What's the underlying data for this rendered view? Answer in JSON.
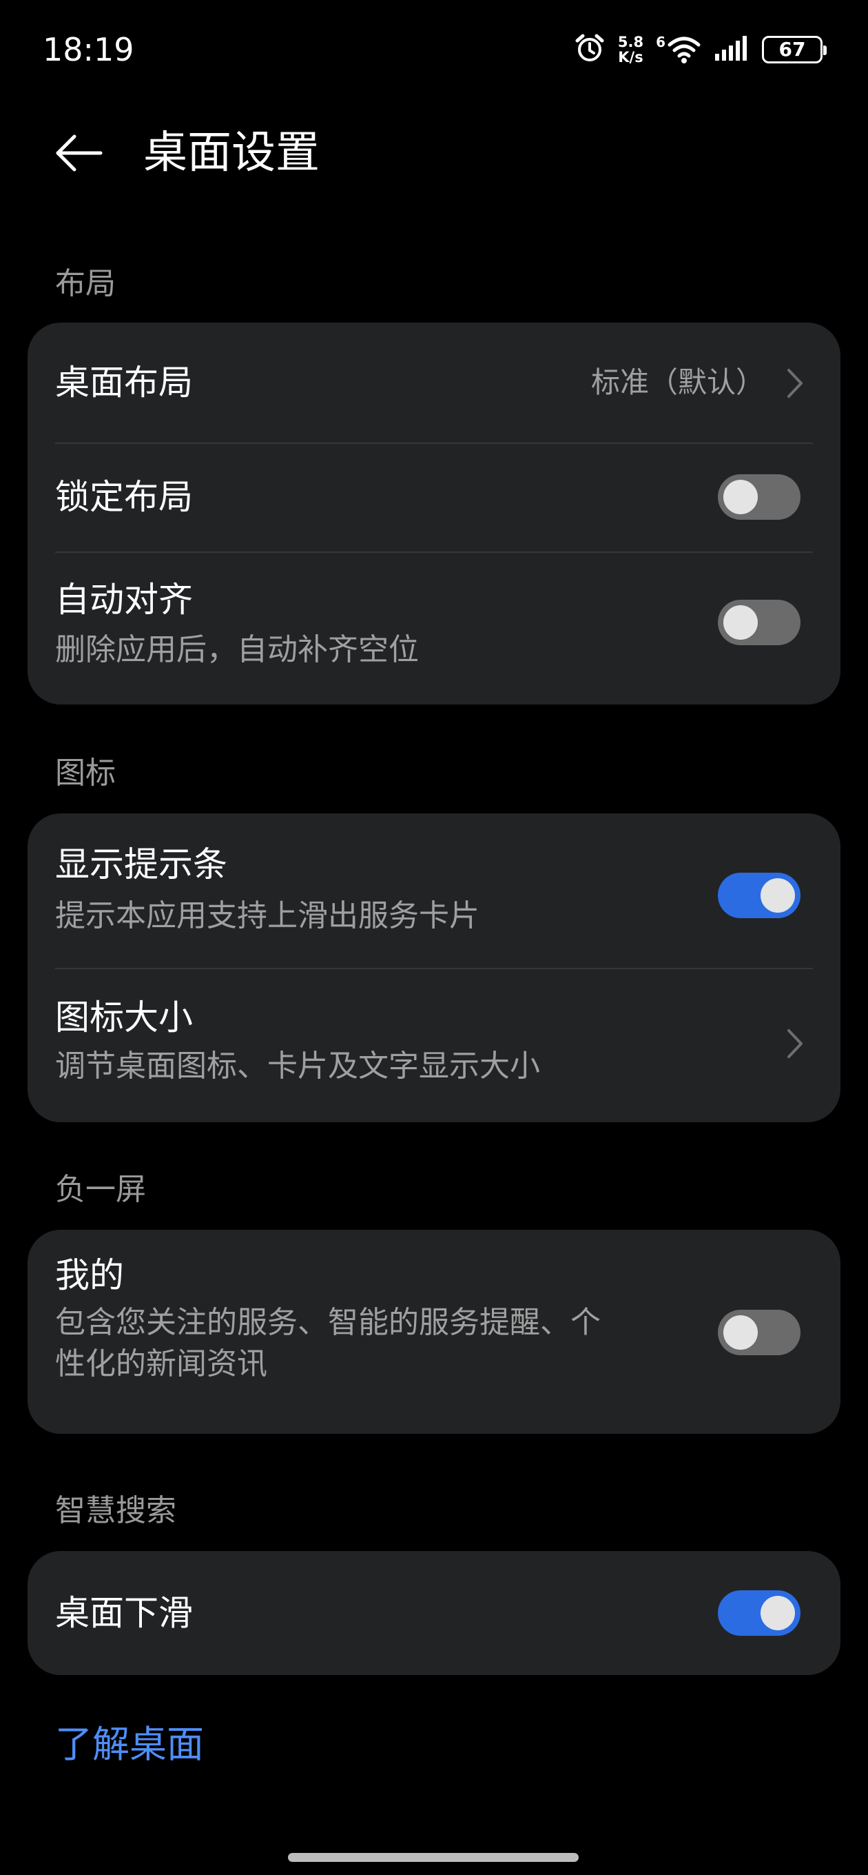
{
  "status_bar": {
    "time": "18:19",
    "net_speed_value": "5.8",
    "net_speed_unit": "K/s",
    "network_generation": "6",
    "battery": "67",
    "icons": [
      "alarm-icon",
      "wifi-icon",
      "signal-icon",
      "battery-icon"
    ]
  },
  "header": {
    "title": "桌面设置",
    "back_icon": "arrow-left-icon"
  },
  "sections": {
    "layout": {
      "title": "布局",
      "desktop_layout": {
        "title": "桌面布局",
        "value": "标准（默认）"
      },
      "lock_layout": {
        "title": "锁定布局",
        "enabled": false
      },
      "auto_align": {
        "title": "自动对齐",
        "subtitle": "删除应用后，自动补齐空位",
        "enabled": false
      }
    },
    "icons": {
      "title": "图标",
      "show_hint_bar": {
        "title": "显示提示条",
        "subtitle": "提示本应用支持上滑出服务卡片",
        "enabled": true
      },
      "icon_size": {
        "title": "图标大小",
        "subtitle": "调节桌面图标、卡片及文字显示大小"
      }
    },
    "minus_one": {
      "title": "负一屏",
      "mine": {
        "title": "我的",
        "subtitle_line1": "包含您关注的服务、智能的服务提醒、个",
        "subtitle_line2": "性化的新闻资讯",
        "enabled": false
      }
    },
    "smart_search": {
      "title": "智慧搜索",
      "swipe_down": {
        "title": "桌面下滑",
        "enabled": true
      }
    }
  },
  "footer": {
    "learn_link": "了解桌面"
  },
  "colors": {
    "background": "#000000",
    "card": "#222325",
    "accent": "#2b6ce3",
    "link": "#4f8ef7",
    "secondary_text": "#a0a0a0"
  }
}
